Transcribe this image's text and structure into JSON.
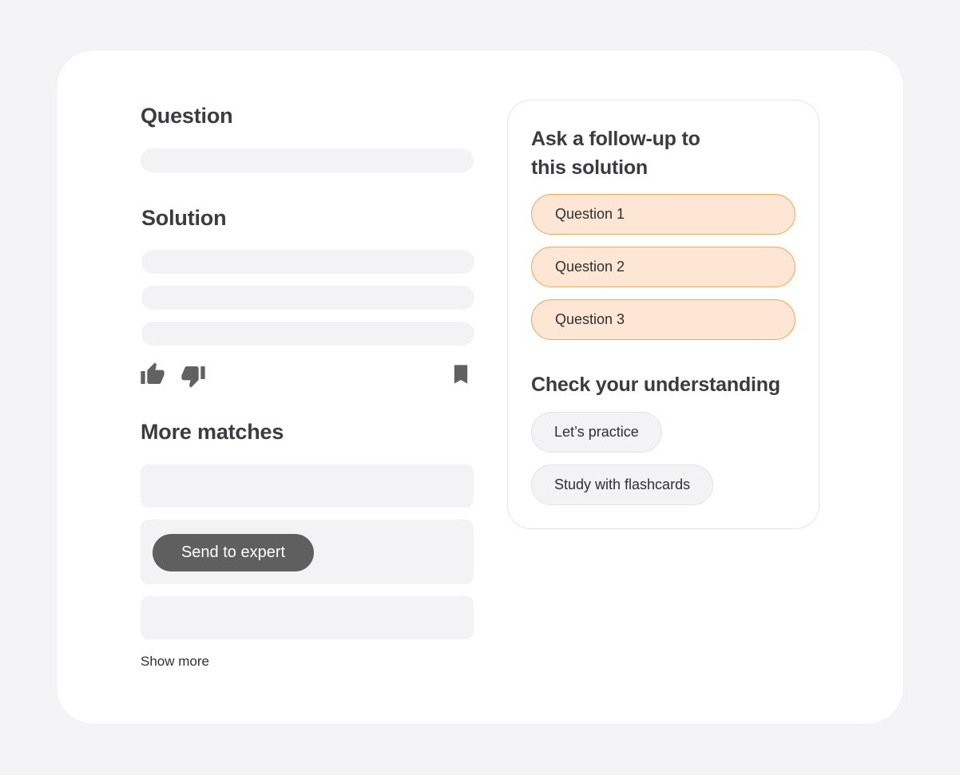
{
  "main": {
    "question_heading": "Question",
    "solution_heading": "Solution",
    "more_matches_heading": "More matches",
    "feedback": {
      "thumbs_up_icon": "thumbs-up-icon",
      "thumbs_down_icon": "thumbs-down-icon",
      "bookmark_icon": "bookmark-icon"
    },
    "send_to_expert_label": "Send to expert",
    "show_more_label": "Show more"
  },
  "side_panel": {
    "follow_up_heading_line1": "Ask a follow-up to",
    "follow_up_heading_line2": "this solution",
    "follow_up_questions": [
      "Question 1",
      "Question 2",
      "Question 3"
    ],
    "check_heading": "Check your understanding",
    "practice_options": [
      "Let’s practice",
      "Study with flashcards"
    ]
  },
  "colors": {
    "accent_fill": "#fee6d4",
    "accent_border": "#f0a557",
    "primary_button": "#5f5f5f",
    "text": "#3c3b41"
  }
}
